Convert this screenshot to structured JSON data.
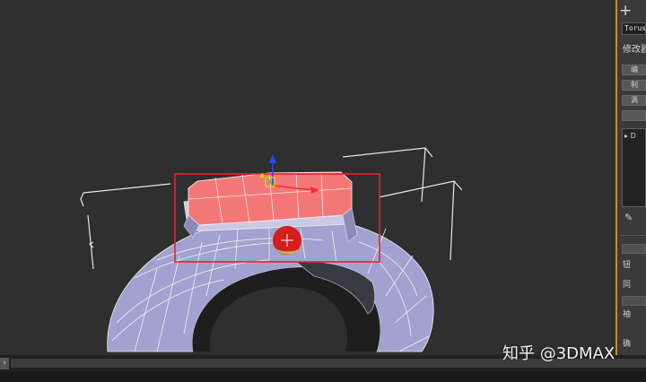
{
  "command_panel": {
    "create_tab_icon": "plus-icon",
    "create_tab_glyph": "+",
    "object_name": "Torus",
    "modifier_list_label": "修改器",
    "modifier_buttons": [
      "编",
      "制",
      "涡",
      ""
    ],
    "modifier_stack": {
      "item_label": "D",
      "expand_icon": "triangle-right-icon"
    },
    "pin_stack_icon": "pin-icon",
    "rollout_labels": [
      "",
      "钮",
      "同",
      "",
      "袖"
    ],
    "bottom_label": "确"
  },
  "selection_box_color": "#e0262f",
  "selected_faces_color": "#f47777",
  "mesh_color": "#9b9bcc",
  "watermark": "知乎 @3DMAX",
  "statusbar": {
    "expand_arrow": "›"
  }
}
